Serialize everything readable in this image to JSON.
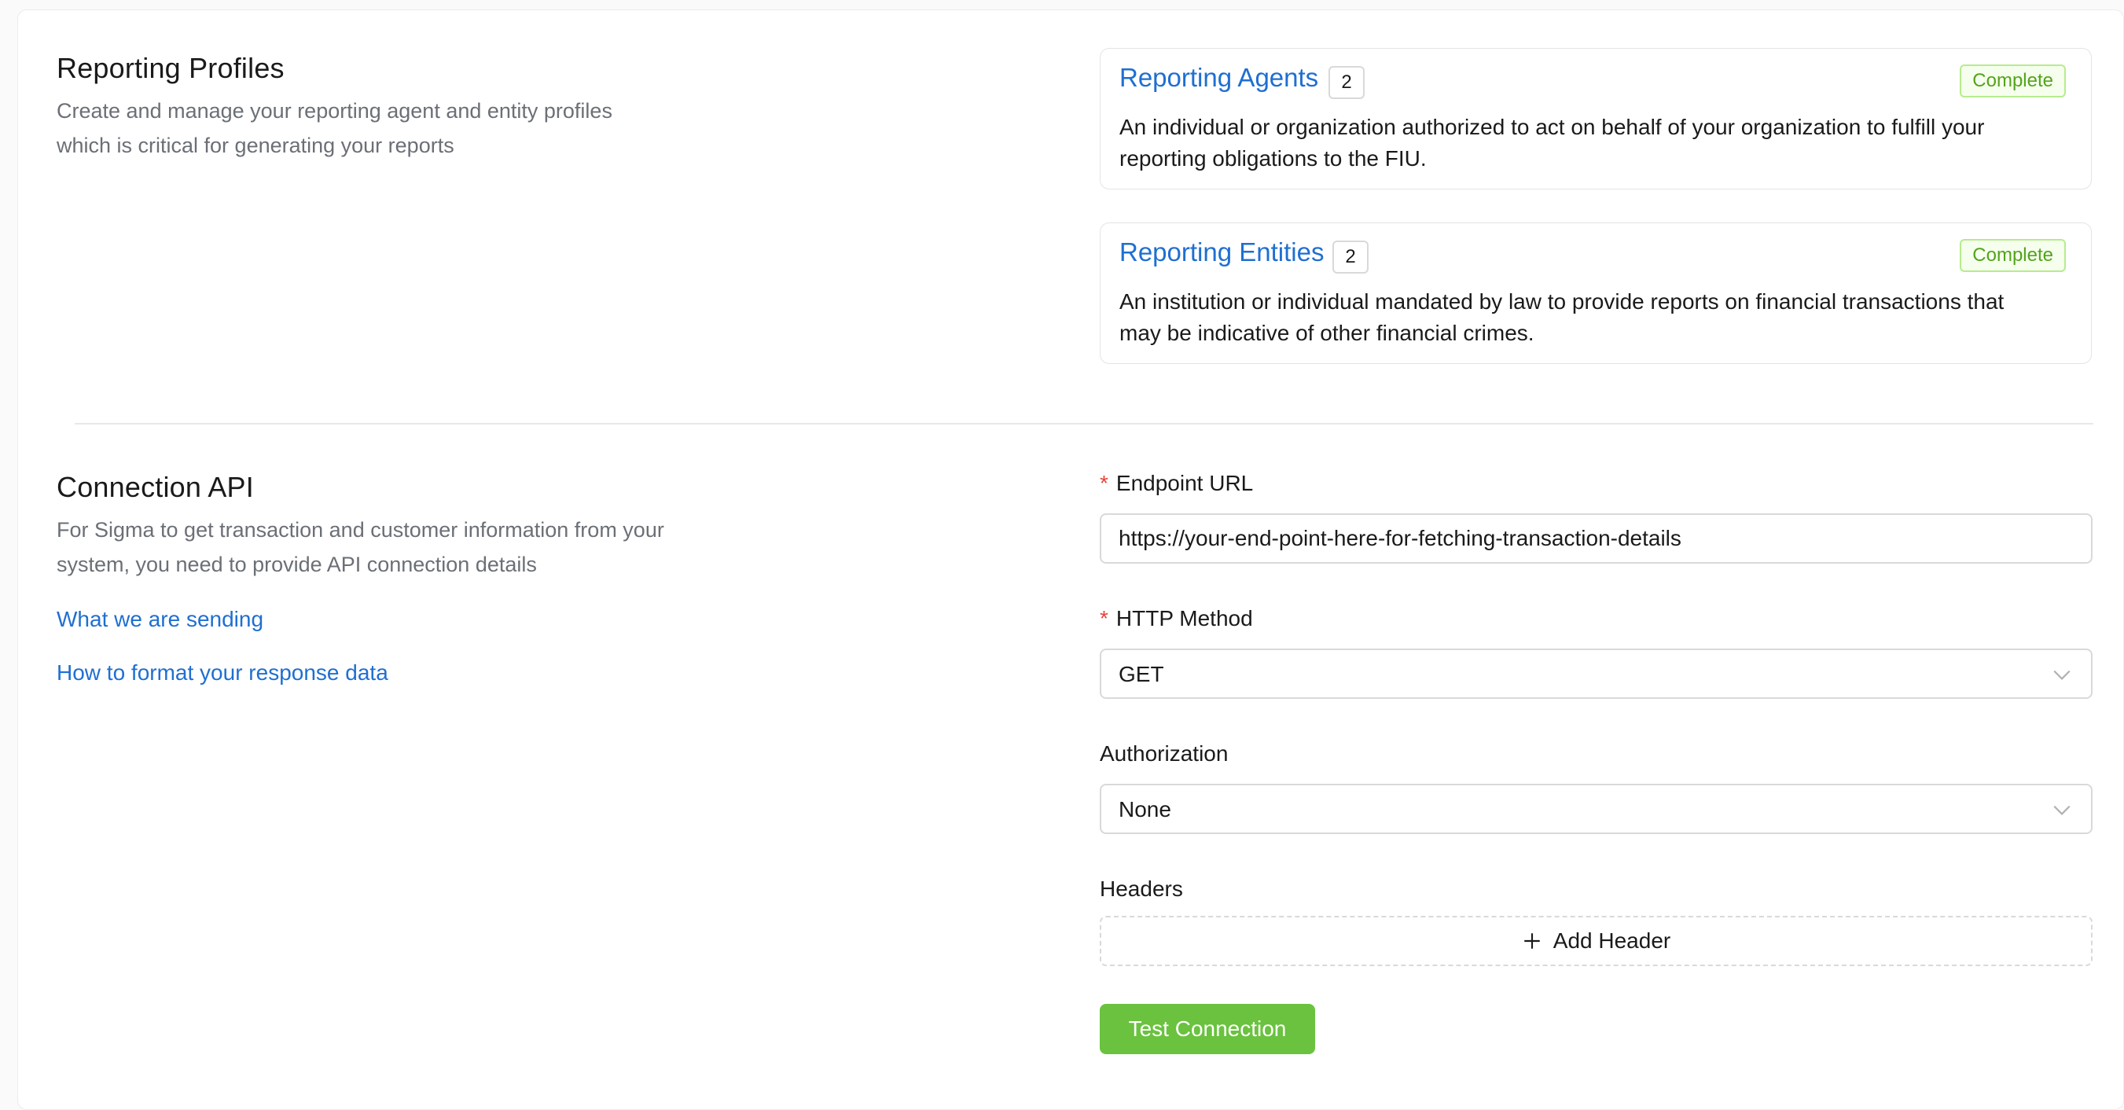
{
  "reporting_profiles": {
    "title": "Reporting Profiles",
    "description_line1": "Create and manage your reporting agent and entity profiles",
    "description_line2": "which is critical for generating your reports",
    "cards": [
      {
        "title": "Reporting Agents",
        "count": "2",
        "status": "Complete",
        "description_line1": "An individual or organization authorized to act on behalf of your organization to fulfill your",
        "description_line2": "reporting obligations to the FIU."
      },
      {
        "title": "Reporting Entities",
        "count": "2",
        "status": "Complete",
        "description_line1": "An institution or individual mandated by law to provide reports on financial transactions that",
        "description_line2": "may be indicative of other financial crimes."
      }
    ]
  },
  "connection_api": {
    "title": "Connection API",
    "description_line1": "For Sigma to get transaction and customer information from your",
    "description_line2": "system, you need to provide API connection details",
    "links": [
      "What we are sending",
      "How to format your response data"
    ],
    "endpoint": {
      "required_mark": "*",
      "label": "Endpoint URL",
      "value": "https://your-end-point-here-for-fetching-transaction-details"
    },
    "http_method": {
      "required_mark": "*",
      "label": "HTTP Method",
      "value": "GET"
    },
    "authorization": {
      "label": "Authorization",
      "value": "None"
    },
    "headers": {
      "label": "Headers",
      "add_label": "Add Header"
    },
    "test_button": "Test Connection"
  },
  "colors": {
    "link": "#1f6fd1",
    "success_tag": "#52a41c",
    "primary_button": "#6ac23f",
    "required": "#e5443c"
  },
  "icons": {
    "select_arrow": "chevron-down-icon",
    "add": "plus-icon"
  }
}
